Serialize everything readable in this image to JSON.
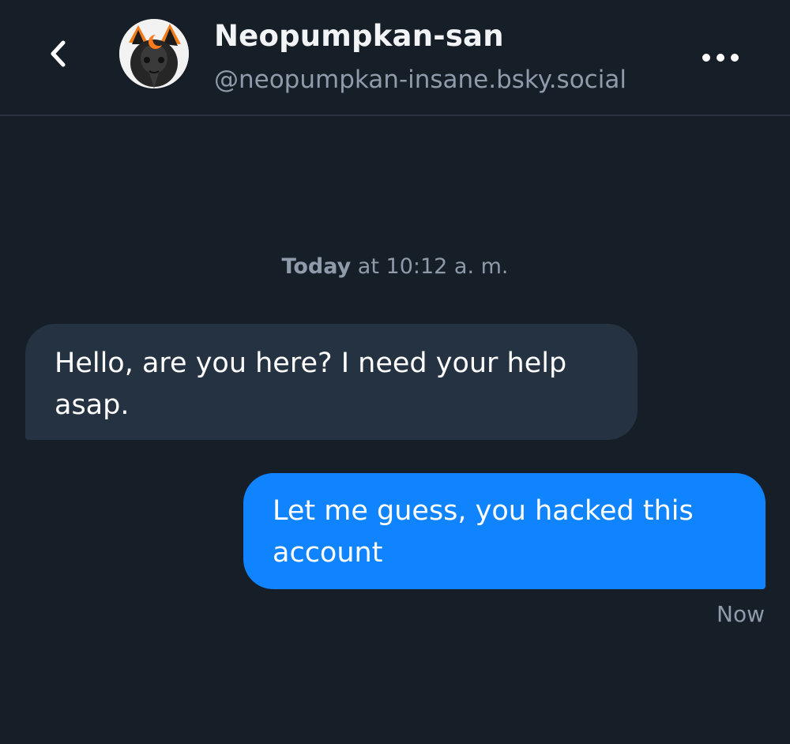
{
  "header": {
    "display_name": "Neopumpkan-san",
    "handle": "@neopumpkan-insane.bsky.social"
  },
  "conversation": {
    "date_separator": {
      "day": "Today",
      "time": "at 10:12 a. m."
    },
    "messages": [
      {
        "direction": "incoming",
        "text": "Hello, are you here? I need your help asap."
      },
      {
        "direction": "outgoing",
        "text": "Let me guess, you hacked this account",
        "sent_label": "Now"
      }
    ]
  },
  "colors": {
    "background": "#161e27",
    "incoming_bubble": "#253241",
    "outgoing_bubble": "#1083fe",
    "muted_text": "#8f9bab"
  },
  "icons": {
    "back": "chevron-left-icon",
    "more": "more-horizontal-icon"
  }
}
